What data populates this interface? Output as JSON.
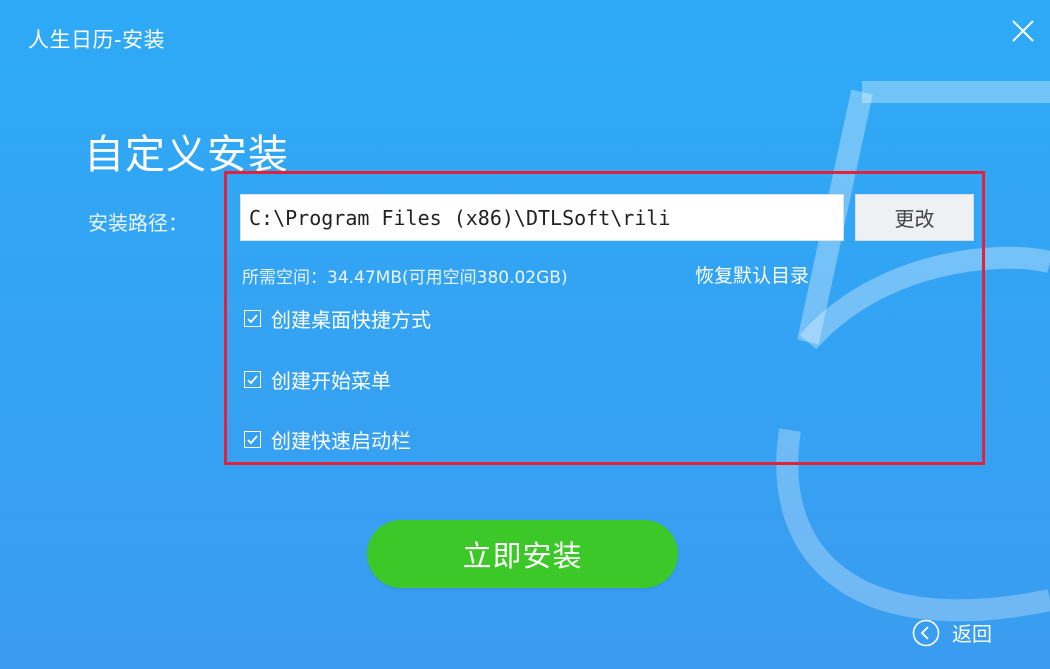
{
  "window": {
    "title": "人生日历-安装"
  },
  "main": {
    "heading": "自定义安装",
    "path_label": "安装路径：",
    "path_value": "C:\\Program Files (x86)\\DTLSoft\\rili",
    "change_button": "更改",
    "space_info": "所需空间：34.47MB(可用空间380.02GB)",
    "restore_default": "恢复默认目录",
    "options": [
      {
        "label": "创建桌面快捷方式",
        "checked": true
      },
      {
        "label": "创建开始菜单",
        "checked": true
      },
      {
        "label": "创建快速启动栏",
        "checked": true
      }
    ],
    "install_button": "立即安装",
    "back_link": "返回"
  },
  "colors": {
    "background": "#2eaaf6",
    "install_green": "#3cc828",
    "highlight_red": "#e0223b"
  },
  "icons": {
    "close": "close-icon",
    "checkbox": "checkbox-checked-icon",
    "back": "back-arrow-circle-icon"
  }
}
